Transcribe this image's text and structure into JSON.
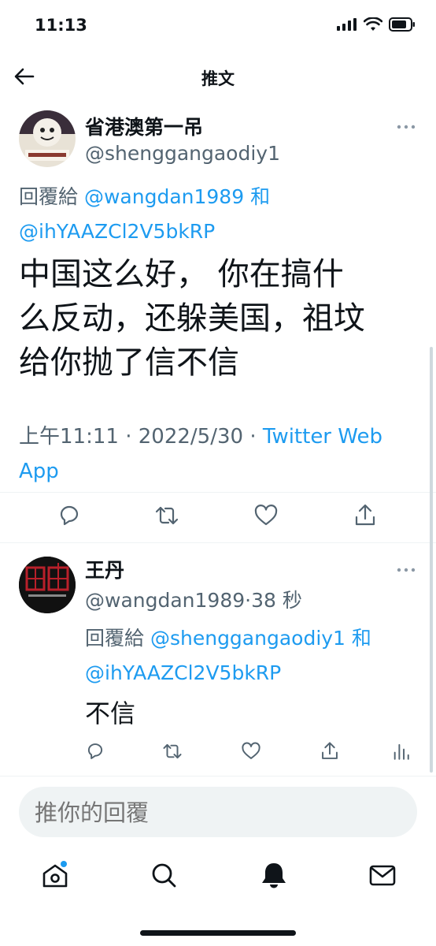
{
  "status": {
    "time": "11:13"
  },
  "header": {
    "title": "推文"
  },
  "tweet": {
    "name": "省港澳第一吊",
    "handle": "@shenggangaodiy1",
    "reply_prefix": "回覆給",
    "reply_user1": "@wangdan1989",
    "reply_and": "和",
    "reply_user2": "@ihYAAZCl2V5bkRP",
    "text_line1": "中国这么好， 你在搞什",
    "text_line2": "么反动，还躲美国，祖坟",
    "text_line3": "给你抛了信不信",
    "time": "上午11:11",
    "sep1": "·",
    "date": "2022/5/30",
    "sep2": "·",
    "source": "Twitter Web App"
  },
  "reply": {
    "name": "王丹",
    "handle": "@wangdan1989",
    "sep": "·",
    "age": "38 秒",
    "reply_prefix": "回覆給",
    "reply_user1": "@shenggangaodiy1",
    "reply_and": "和",
    "reply_user2": "@ihYAAZCl2V5bkRP",
    "text": "不信"
  },
  "compose": {
    "placeholder": "推你的回覆"
  },
  "colors": {
    "accent": "#1d9bf0",
    "text": "#0f1419",
    "muted": "#536471"
  },
  "icons": [
    "back-arrow-icon",
    "reply-icon",
    "retweet-icon",
    "like-icon",
    "share-icon",
    "analytics-icon",
    "home-icon",
    "search-icon",
    "notifications-icon",
    "messages-icon",
    "more-icon"
  ]
}
